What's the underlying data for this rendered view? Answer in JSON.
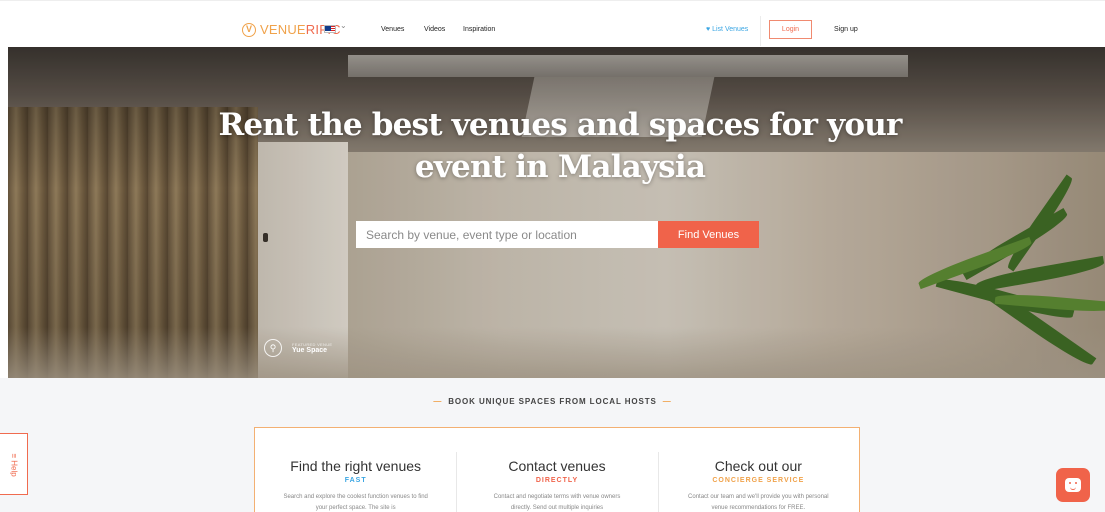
{
  "nav": {
    "logo_mark": "V",
    "logo_first": "VENUE",
    "logo_second": "RIFIC",
    "country_icon": "malaysia-flag-icon",
    "links": [
      "Venues",
      "Videos",
      "Inspiration"
    ],
    "list_venues": "♥ List Venues",
    "login": "Login",
    "signup": "Sign up"
  },
  "hero": {
    "title": "Rent the best venues and spaces for your event in Malaysia",
    "search_placeholder": "Search by venue, event type or location",
    "search_button": "Find Venues",
    "featured_label": "FEATURED VENUE",
    "featured_venue": "Yue Space"
  },
  "tagline": "BOOK UNIQUE SPACES FROM LOCAL HOSTS",
  "features": [
    {
      "title": "Find the right venues",
      "subtitle": "FAST",
      "body": "Search and explore the coolest function venues to find your perfect space. The site is",
      "color": "#3ba6e3"
    },
    {
      "title": "Contact venues",
      "subtitle": "DIRECTLY",
      "body": "Contact and negotiate terms with venue owners directly. Send out multiple inquiries",
      "color": "#f0634a"
    },
    {
      "title": "Check out our",
      "subtitle": "CONCIERGE SERVICE",
      "body": "Contact our team and we'll provide you with personal venue recommendations for FREE.",
      "color": "#f0a24a"
    }
  ],
  "help_tab": "≡ Help",
  "colors": {
    "brand_orange": "#f0a24a",
    "accent_red": "#f0634a",
    "link_blue": "#3ba6e3"
  }
}
